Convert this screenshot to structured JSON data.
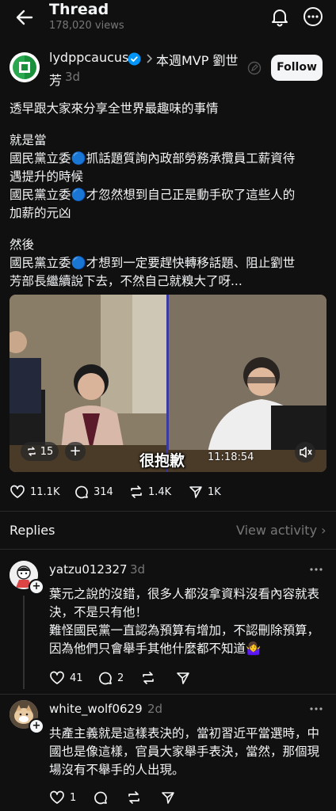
{
  "header": {
    "title": "Thread",
    "views": "178,020 views",
    "icons": [
      "back-arrow-icon",
      "bell-icon",
      "more-icon"
    ]
  },
  "post": {
    "username": "lydppcaucus",
    "topic_line1": "本週MVP 劉世",
    "topic_line2": "芳",
    "time": "3d",
    "follow_label": "Follow",
    "body": [
      "透早跟大家來分享全世界最趣味的事情",
      "",
      "就是當",
      "國民黨立委🔵抓話題質詢內政部勞務承攬員工薪資待",
      "遇提升的時候",
      "國民黨立委🔵才忽然想到自己正是動手砍了這些人的",
      "加薪的元凶",
      "",
      "然後",
      "國民黨立委🔵才想到一定要趕快轉移話題、阻止劉世",
      "芳部長繼續說下去，不然自己就糗大了呀..."
    ],
    "video": {
      "repost_count": "15",
      "subtitle": "很抱歉",
      "timestamp": "11:18:54"
    },
    "stats": {
      "likes": "11.1K",
      "comments": "314",
      "reposts": "1.4K",
      "shares": "1K"
    }
  },
  "replies_section": {
    "title": "Replies",
    "view_activity": "View activity"
  },
  "replies": [
    {
      "username": "yatzu012327",
      "time": "3d",
      "lines": [
        "葉元之說的沒錯，很多人都沒拿資料沒看內容就表",
        "決，不是只有他！",
        "難怪國民黨一直認為預算有增加，不認刪除預算，",
        "因為他們只會舉手其他什麼都不知道🤷‍♀️"
      ],
      "likes": "41",
      "comments": "2"
    },
    {
      "username": "white_wolf0629",
      "time": "2d",
      "lines": [
        "共產主義就是這樣表決的，當初習近平當選時，中",
        "國也是像這樣，官員大家舉手表決，當然，那個現",
        "場沒有不舉手的人出現。"
      ],
      "likes": "1",
      "comments": ""
    }
  ],
  "colors": {
    "background": "#101010",
    "text": "#f3f5f7",
    "muted": "#777777",
    "verified": "#0095f6"
  }
}
